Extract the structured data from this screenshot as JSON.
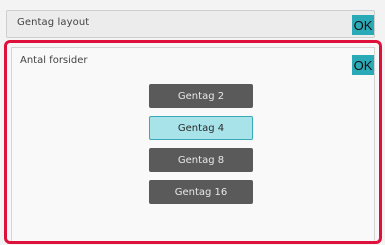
{
  "header": {
    "title": "Gentag layout",
    "ok_label": "OK"
  },
  "panel": {
    "title": "Antal forsider",
    "ok_label": "OK",
    "options": [
      {
        "label": "Gentag 2",
        "selected": false
      },
      {
        "label": "Gentag 4",
        "selected": true
      },
      {
        "label": "Gentag 8",
        "selected": false
      },
      {
        "label": "Gentag 16",
        "selected": false
      }
    ]
  },
  "colors": {
    "accent": "#2aa9b7",
    "selected_fill": "#a8e3ea",
    "button_fill": "#5a5a5a",
    "panel_border": "#e0103c"
  }
}
